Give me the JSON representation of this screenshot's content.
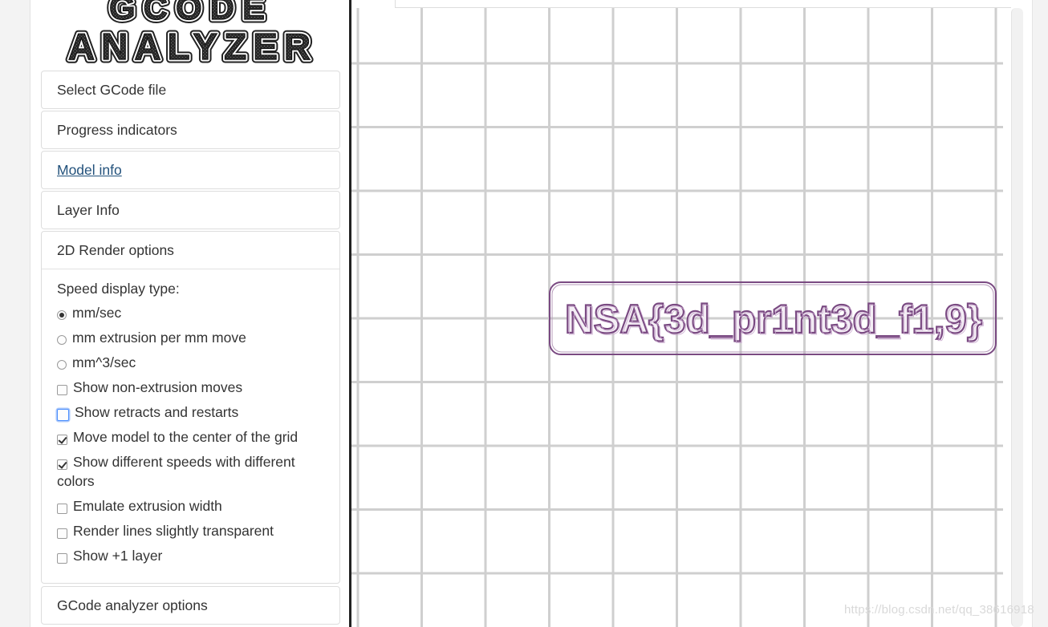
{
  "logo": {
    "line1": "GCODE",
    "line2": "ANALYZER"
  },
  "panels": {
    "select_file": "Select GCode file",
    "progress": "Progress indicators",
    "model_info": "Model info",
    "layer_info": "Layer Info",
    "render_options": "2D Render options",
    "analyzer_options": "GCode analyzer options"
  },
  "render_options": {
    "speed_title": "Speed display type:",
    "radio_mmsec": "mm/sec",
    "radio_extrusion": "mm extrusion per mm move",
    "radio_mm3sec": "mm^3/sec",
    "check_nonextrusion": "Show non-extrusion moves",
    "check_retracts": "Show retracts and restarts",
    "check_center": "Move model to the center of the grid",
    "check_speeds": "Show different speeds with different colors",
    "check_width": "Emulate extrusion width",
    "check_transparent": "Render lines slightly transparent",
    "check_plus1": "Show +1 layer"
  },
  "model_render": {
    "text": "NSA{3d_pr1nt3d_f1,9}",
    "color": "#7a4a82"
  },
  "watermark": "https://blog.csdn.net/qq_38616918"
}
